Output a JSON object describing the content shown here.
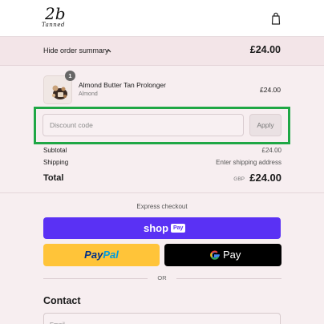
{
  "header": {
    "logo_text": "2b",
    "logo_sub": "Tanned",
    "bag_icon": "shopping-bag-icon"
  },
  "summary": {
    "toggle_label": "Hide order summary",
    "toggle_icon": "chevron-up-icon",
    "total": "£24.00"
  },
  "cart": {
    "items": [
      {
        "name": "Almond Butter Tan Prolonger",
        "variant": "Almond",
        "price": "£24.00",
        "quantity": "1"
      }
    ]
  },
  "discount": {
    "placeholder": "Discount code",
    "apply_label": "Apply"
  },
  "totals": {
    "subtotal_label": "Subtotal",
    "subtotal_value": "£24.00",
    "shipping_label": "Shipping",
    "shipping_value": "Enter shipping address",
    "total_label": "Total",
    "currency": "GBP",
    "total_value": "£24.00"
  },
  "express": {
    "heading": "Express checkout",
    "shop_label": "shop",
    "shop_pay_badge": "Pay",
    "paypal_label_1": "Pay",
    "paypal_label_2": "Pal",
    "gpay_label": "Pay",
    "or_label": "OR"
  },
  "contact": {
    "heading": "Contact",
    "email_placeholder": "Email"
  },
  "colors": {
    "highlight": "#1fa745",
    "shop_pay": "#5a31f4",
    "paypal": "#ffc439",
    "gpay": "#000000"
  }
}
